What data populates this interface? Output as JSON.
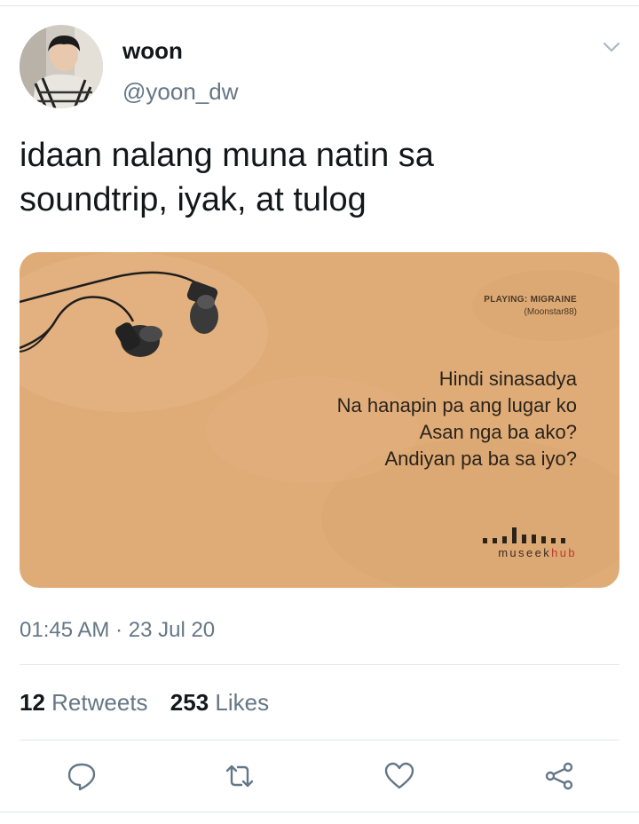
{
  "user": {
    "display_name": "woon",
    "handle": "@yoon_dw"
  },
  "tweet": {
    "text_line1": "idaan nalang muna natin sa",
    "text_line2": "soundtrip, iyak, at tulog",
    "timestamp": "01:45 AM · 23 Jul 20"
  },
  "media": {
    "playing": "PLAYING: MIGRAINE",
    "artist": "(Moonstar88)",
    "lyrics": [
      "Hindi sinasadya",
      "Na hanapin pa ang lugar ko",
      "Asan nga ba ako?",
      "Andiyan pa ba sa iyo?"
    ],
    "brand_a": "museek",
    "brand_b": "hub"
  },
  "stats": {
    "retweets_count": "12",
    "retweets_label": "Retweets",
    "likes_count": "253",
    "likes_label": "Likes"
  },
  "icons": {
    "caret": "chevron-down-icon",
    "reply": "reply-icon",
    "retweet": "retweet-icon",
    "like": "heart-icon",
    "share": "share-icon"
  },
  "colors": {
    "secondary_text": "#657786",
    "card_background": "#dfac78",
    "brand_accent": "#c0392b"
  }
}
